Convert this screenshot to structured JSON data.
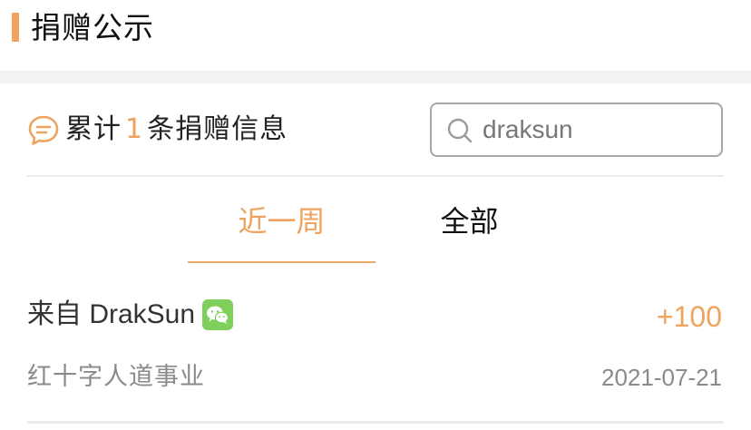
{
  "header": {
    "title": "捐赠公示"
  },
  "summary": {
    "prefix": "累计",
    "count": "1",
    "suffix": "条捐赠信息",
    "icon": "chat-bubble-icon"
  },
  "search": {
    "value": "draksun",
    "icon": "search-icon"
  },
  "tabs": [
    {
      "label": "近一周",
      "active": true
    },
    {
      "label": "全部",
      "active": false
    }
  ],
  "records": [
    {
      "donor": "来自 DrakSun",
      "source_icon": "wechat-icon",
      "amount": "+100",
      "project": "红十字人道事业",
      "date": "2021-07-21"
    }
  ],
  "colors": {
    "accent": "#f0a35e",
    "wechat": "#7ed05a"
  }
}
